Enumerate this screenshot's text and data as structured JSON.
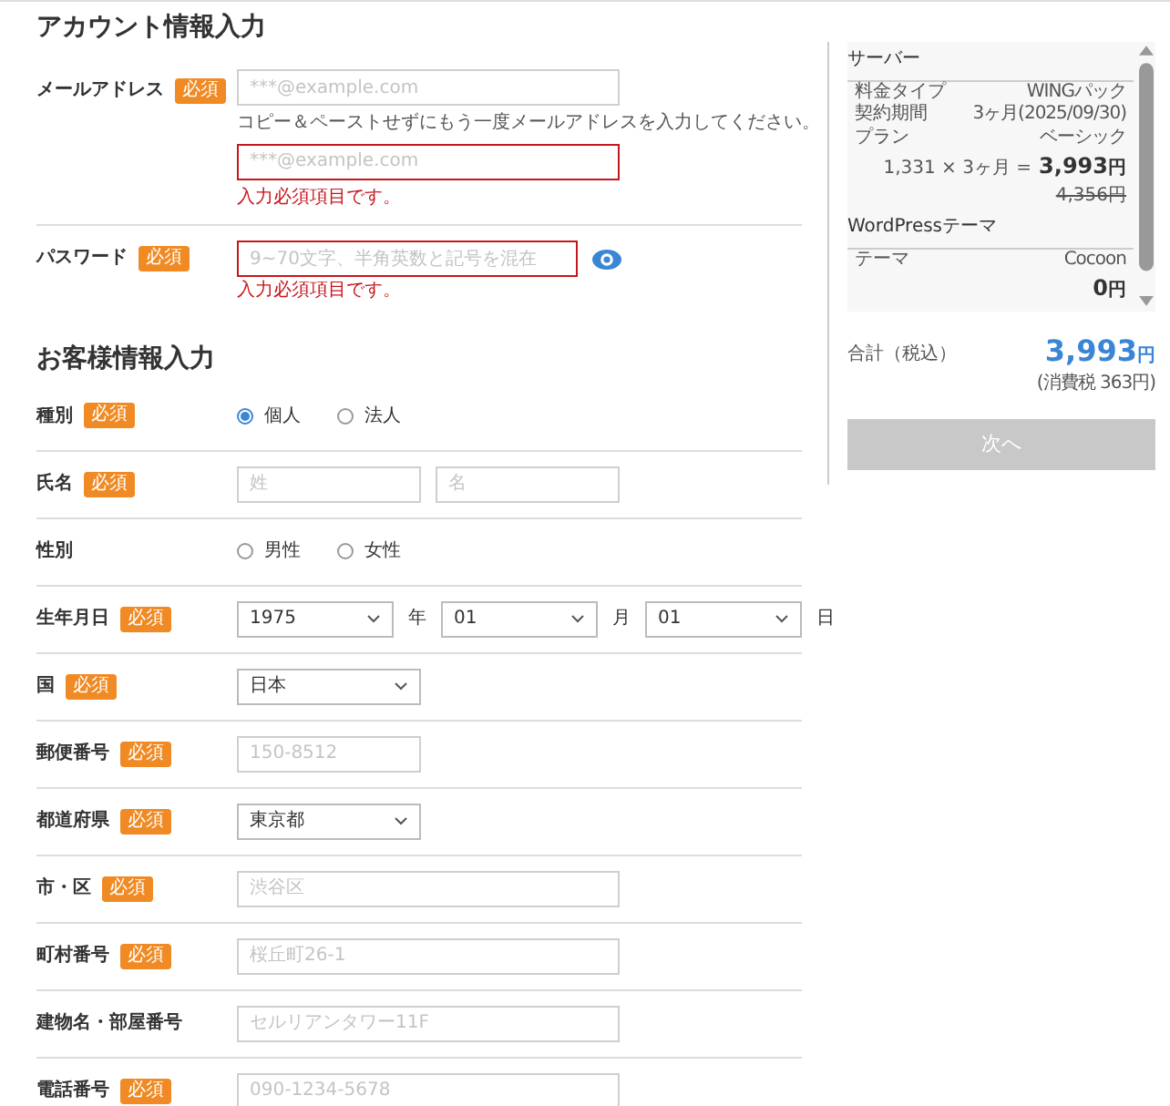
{
  "account": {
    "title": "アカウント情報入力",
    "email": {
      "label": "メールアドレス",
      "badge": "必須",
      "placeholder": "***@example.com",
      "hint": "コピー＆ペーストせずにもう一度メールアドレスを入力してください。",
      "confirm": {
        "placeholder": "***@example.com",
        "invalid": true,
        "error": "入力必須項目です。"
      }
    },
    "password": {
      "label": "パスワード",
      "badge": "必須",
      "placeholder": "9~70文字、半角英数と記号を混在",
      "invalid": true,
      "error": "入力必須項目です。"
    }
  },
  "customer": {
    "title": "お客様情報入力",
    "rows": [
      {
        "kind": "radio",
        "label": "種別",
        "badge": "必須",
        "options": [
          {
            "label": "個人",
            "selected": true
          },
          {
            "label": "法人",
            "selected": false
          }
        ]
      },
      {
        "kind": "name",
        "label": "氏名",
        "badge": "必須",
        "placeholders": [
          "姓",
          "名"
        ]
      },
      {
        "kind": "radio",
        "label": "性別",
        "options": [
          {
            "label": "男性",
            "selected": false
          },
          {
            "label": "女性",
            "selected": false
          }
        ]
      },
      {
        "kind": "date",
        "label": "生年月日",
        "badge": "必須",
        "parts": [
          {
            "value": "1975",
            "unit": "年"
          },
          {
            "value": "01",
            "unit": "月"
          },
          {
            "value": "01",
            "unit": "日"
          }
        ]
      },
      {
        "kind": "select",
        "label": "国",
        "badge": "必須",
        "value": "日本"
      },
      {
        "kind": "short",
        "label": "郵便番号",
        "badge": "必須",
        "placeholder": "150-8512"
      },
      {
        "kind": "select",
        "label": "都道府県",
        "badge": "必須",
        "value": "東京都"
      },
      {
        "kind": "long",
        "label": "市・区",
        "badge": "必須",
        "placeholder": "渋谷区"
      },
      {
        "kind": "long",
        "label": "町村番号",
        "badge": "必須",
        "placeholder": "桜丘町26-1"
      },
      {
        "kind": "long",
        "label": "建物名・部屋番号",
        "placeholder": "セルリアンタワー11F"
      },
      {
        "kind": "long",
        "label": "電話番号",
        "badge": "必須",
        "placeholder": "090-1234-5678"
      }
    ]
  },
  "summary": {
    "sections": [
      {
        "title": "サーバー",
        "rows": [
          {
            "label": "料金タイプ",
            "value": "WINGパック"
          },
          {
            "label": "契約期間",
            "value": "3ヶ月(2025/09/30)"
          },
          {
            "label": "プラン",
            "value": "ベーシック"
          }
        ],
        "formula": "1,331 × 3ヶ月 =",
        "price": "3,993",
        "unit": "円",
        "old_price": "4,356円"
      },
      {
        "title": "WordPressテーマ",
        "rows": [
          {
            "label": "テーマ",
            "value": "Cocoon"
          }
        ],
        "price": "0",
        "unit": "円"
      }
    ],
    "total": {
      "label": "合計（税込）",
      "price": "3,993",
      "unit": "円",
      "tax": "(消費税 363円)"
    },
    "next_button": {
      "label": "次へ",
      "disabled": true
    }
  }
}
